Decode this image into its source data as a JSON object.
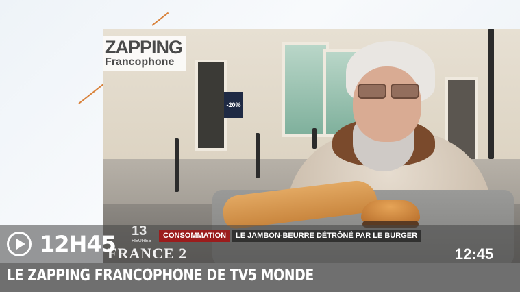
{
  "logo": {
    "line1": "ZAPPING",
    "line2": "Francophone"
  },
  "video": {
    "shop_sign": "-20%",
    "news_bug": {
      "hour": "13",
      "hour_sub": "HEURES",
      "channel": "FRANCE 2"
    },
    "chyron": {
      "category": "CONSOMMATION",
      "headline": "LE JAMBON-BEURRE DÉTRÔNÉ PAR LE BURGER"
    },
    "clock_bug": "12:45"
  },
  "player": {
    "time": "12H45",
    "title": "LE ZAPPING FRANCOPHONE DE TV5 MONDE",
    "play_icon": "play-icon"
  }
}
